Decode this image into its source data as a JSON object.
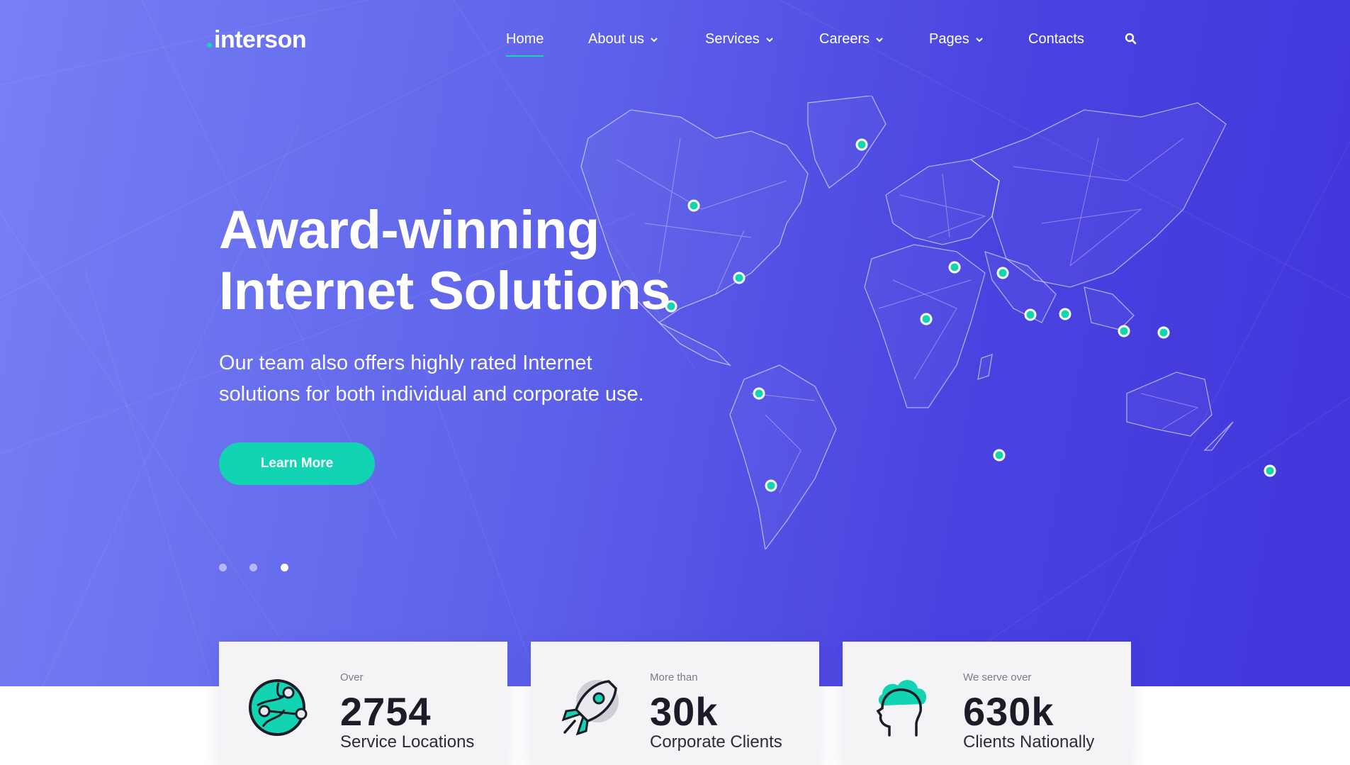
{
  "brand": {
    "name": "interson",
    "accent": "#1ad3b4"
  },
  "nav": {
    "items": [
      {
        "label": "Home",
        "active": true
      },
      {
        "label": "About us",
        "dropdown": true
      },
      {
        "label": "Services",
        "dropdown": true
      },
      {
        "label": "Careers",
        "dropdown": true
      },
      {
        "label": "Pages",
        "dropdown": true
      },
      {
        "label": "Contacts"
      }
    ],
    "search_icon": "search-icon"
  },
  "hero": {
    "title_line1": "Award-winning",
    "title_line2": "Internet Solutions",
    "subtitle_line1": "Our team also offers highly rated Internet",
    "subtitle_line2": "solutions for both individual and corporate use.",
    "cta_label": "Learn More",
    "slides": {
      "count": 3,
      "active": 3
    },
    "map_icon": "world-map-graphic"
  },
  "stats": [
    {
      "prefix": "Over",
      "value": "2754",
      "label": "Service Locations",
      "icon": "globe-network-icon"
    },
    {
      "prefix": "More than",
      "value": "30k",
      "label": "Corporate Clients",
      "icon": "rocket-icon"
    },
    {
      "prefix": "We serve over",
      "value": "630k",
      "label": "Clients Nationally",
      "icon": "head-cloud-icon"
    }
  ],
  "colors": {
    "hero_start": "#7780f4",
    "hero_end": "#4235dc",
    "accent": "#12d4b3",
    "card_bg": "#f4f4f6"
  }
}
